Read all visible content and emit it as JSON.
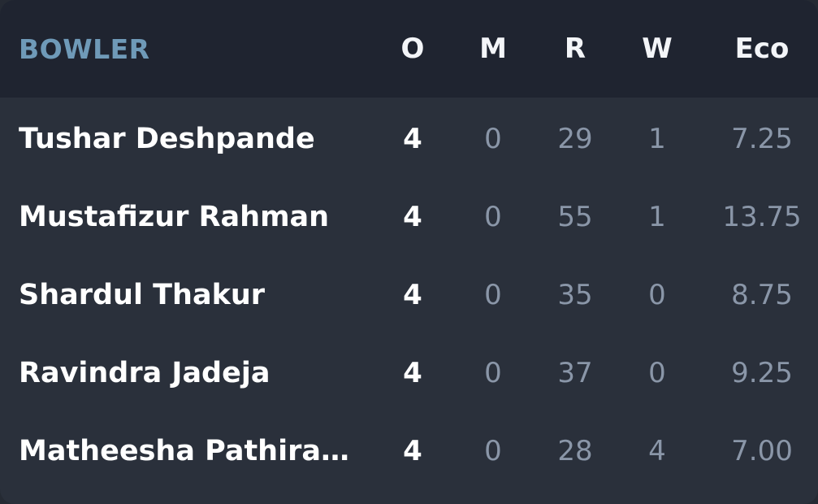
{
  "header": {
    "bowler": "BOWLER",
    "overs": "O",
    "maidens": "M",
    "runs": "R",
    "wickets": "W",
    "economy": "Eco"
  },
  "bowlers": [
    {
      "name": "Tushar Deshpande",
      "overs": "4",
      "maidens": "0",
      "runs": "29",
      "wickets": "1",
      "economy": "7.25"
    },
    {
      "name": "Mustafizur Rahman",
      "overs": "4",
      "maidens": "0",
      "runs": "55",
      "wickets": "1",
      "economy": "13.75"
    },
    {
      "name": "Shardul Thakur",
      "overs": "4",
      "maidens": "0",
      "runs": "35",
      "wickets": "0",
      "economy": "8.75"
    },
    {
      "name": "Ravindra Jadeja",
      "overs": "4",
      "maidens": "0",
      "runs": "37",
      "wickets": "0",
      "economy": "9.25"
    },
    {
      "name": "Matheesha Pathirana...",
      "overs": "4",
      "maidens": "0",
      "runs": "28",
      "wickets": "4",
      "economy": "7.00"
    }
  ],
  "colors": {
    "background": "#2a303b",
    "header_background": "#1f2430",
    "bowler_header": "#6f9ab8",
    "primary_text": "#ffffff",
    "muted_text": "#8a96a8"
  }
}
